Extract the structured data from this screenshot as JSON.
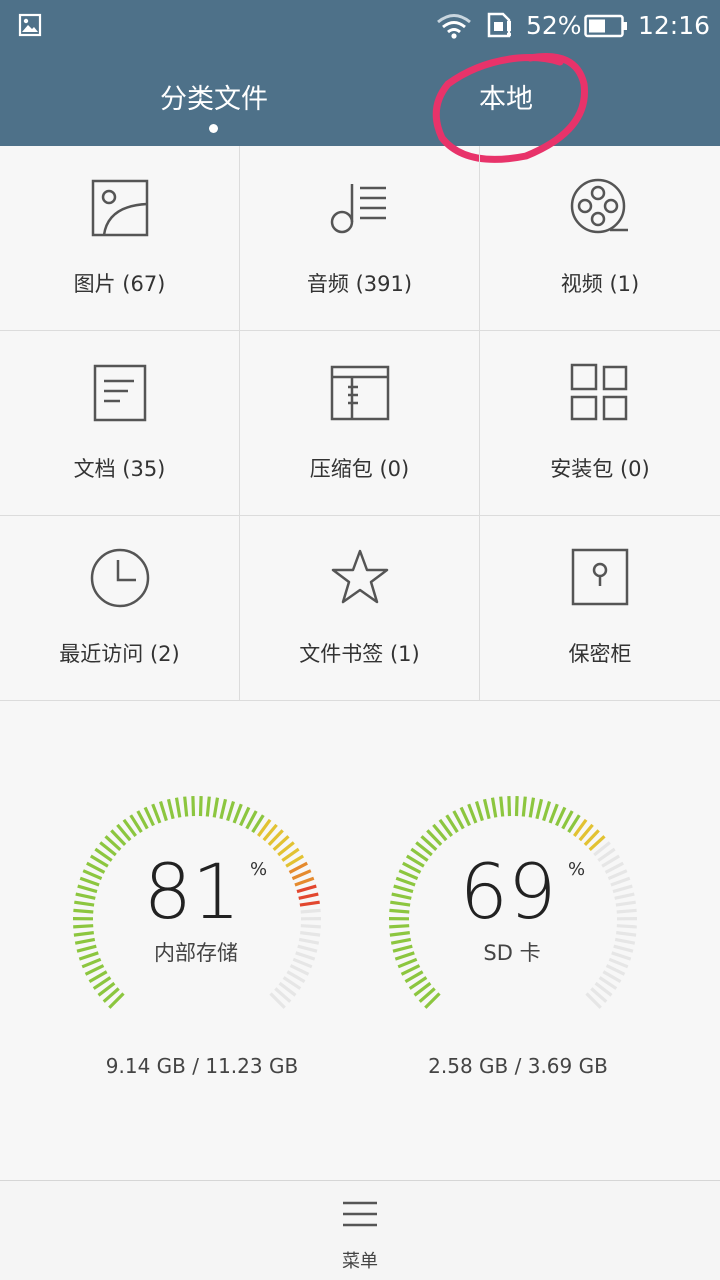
{
  "status_bar": {
    "battery_percent": "52%",
    "time": "12:16",
    "icons": [
      "image-notification-icon",
      "wifi-icon",
      "sim-card-icon",
      "battery-icon"
    ]
  },
  "tabs": [
    {
      "label": "分类文件",
      "active": true
    },
    {
      "label": "本地",
      "active": false
    }
  ],
  "categories": [
    {
      "label": "图片 (67)",
      "icon": "image-icon"
    },
    {
      "label": "音频 (391)",
      "icon": "music-list-icon"
    },
    {
      "label": "视频 (1)",
      "icon": "film-reel-icon"
    },
    {
      "label": "文档 (35)",
      "icon": "document-icon"
    },
    {
      "label": "压缩包 (0)",
      "icon": "archive-icon"
    },
    {
      "label": "安装包 (0)",
      "icon": "app-grid-icon"
    },
    {
      "label": "最近访问 (2)",
      "icon": "clock-icon"
    },
    {
      "label": "文件书签 (1)",
      "icon": "star-icon"
    },
    {
      "label": "保密柜",
      "icon": "safe-icon"
    }
  ],
  "storage": [
    {
      "percent": "81",
      "percent_sign": "%",
      "name": "内部存储",
      "usage": "9.14 GB / 11.23 GB",
      "fill": 0.81
    },
    {
      "percent": "69",
      "percent_sign": "%",
      "name": "SD 卡",
      "usage": "2.58 GB / 3.69 GB",
      "fill": 0.69
    }
  ],
  "bottom_bar": {
    "menu_label": "菜单",
    "icon": "menu-icon"
  },
  "colors": {
    "header": "#4e7189",
    "annotation": "#e8336a",
    "gauge_green": "#8cc63f",
    "gauge_yellow": "#e2c232",
    "gauge_orange": "#e58a2e",
    "gauge_red": "#e2472f",
    "gauge_empty": "#e6e6e6"
  }
}
